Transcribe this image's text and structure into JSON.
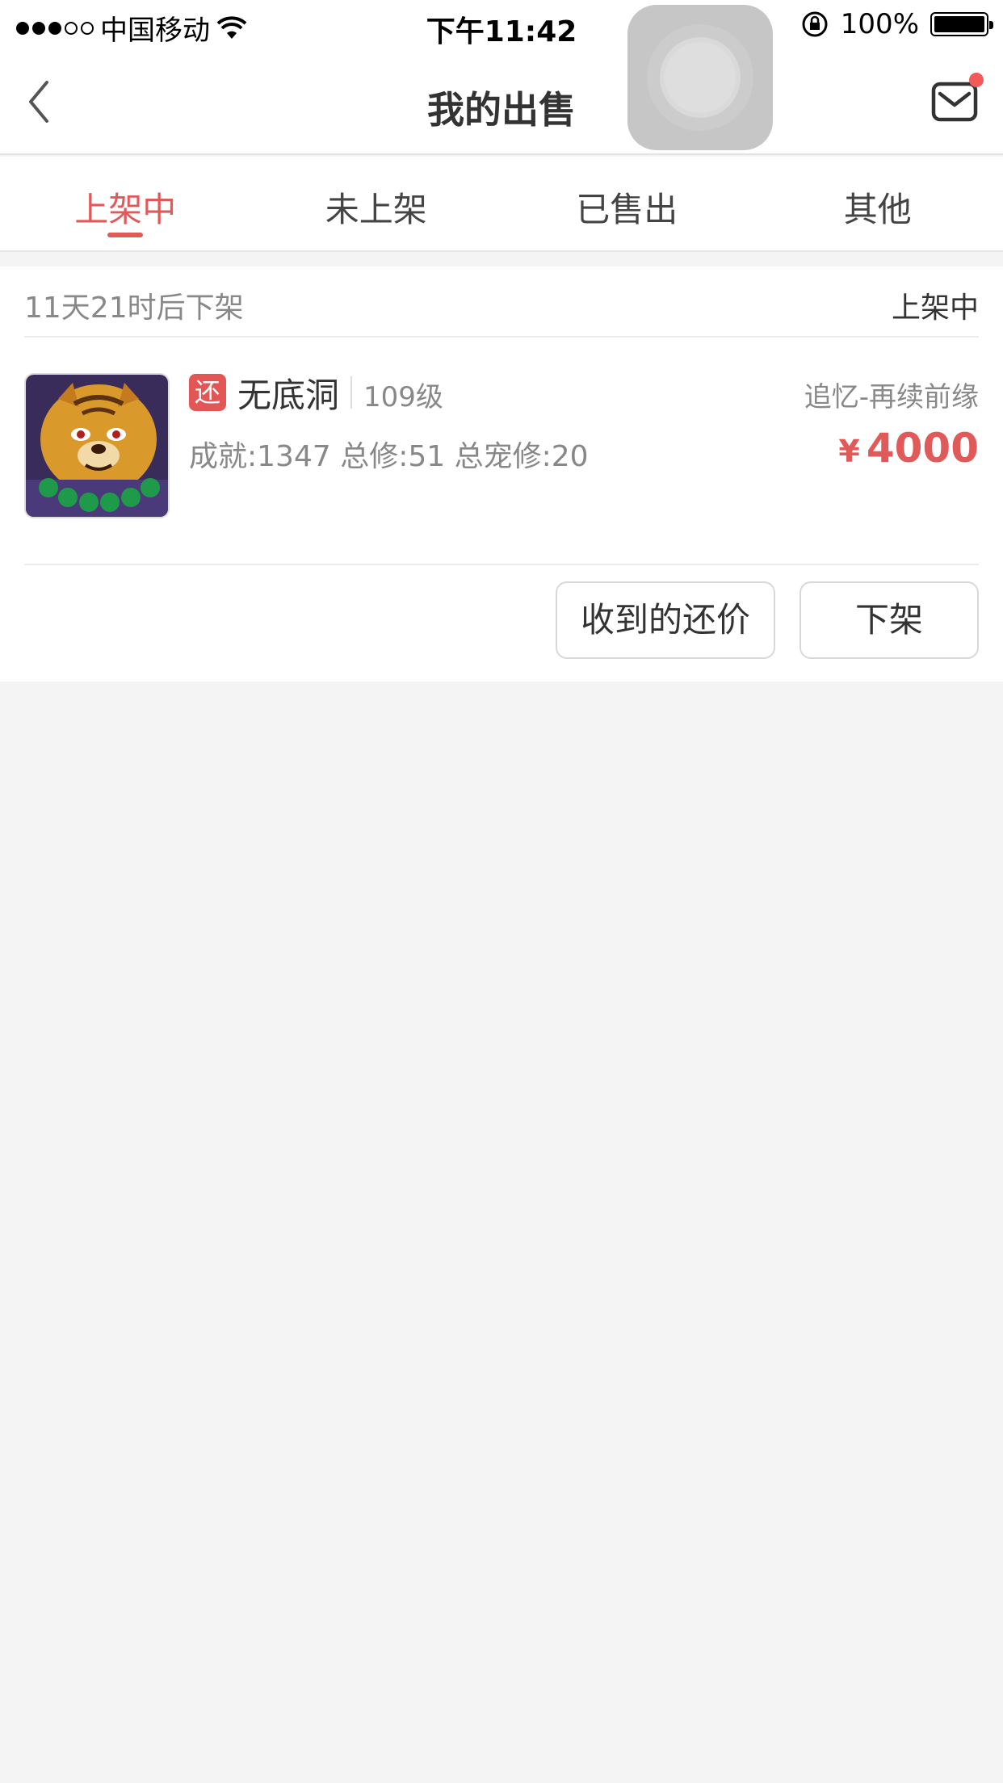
{
  "status_bar": {
    "carrier": "中国移动",
    "time": "下午11:42",
    "battery": "100%",
    "signal_bars": 3,
    "signal_total": 5
  },
  "nav": {
    "title": "我的出售"
  },
  "tabs": [
    {
      "label": "上架中",
      "active": true
    },
    {
      "label": "未上架",
      "active": false
    },
    {
      "label": "已售出",
      "active": false
    },
    {
      "label": "其他",
      "active": false
    }
  ],
  "listing": {
    "countdown": "11天21时后下架",
    "status": "上架中",
    "tag": "还",
    "name": "无底洞",
    "level": "109级",
    "server": "追忆-再续前缘",
    "stats": "成就:1347 总修:51 总宠修:20",
    "currency": "¥",
    "price": "4000",
    "buttons": {
      "offers": "收到的还价",
      "delist": "下架"
    }
  },
  "colors": {
    "accent": "#e05a5a",
    "background": "#f4f4f4",
    "tag_bg": "#e25656"
  }
}
